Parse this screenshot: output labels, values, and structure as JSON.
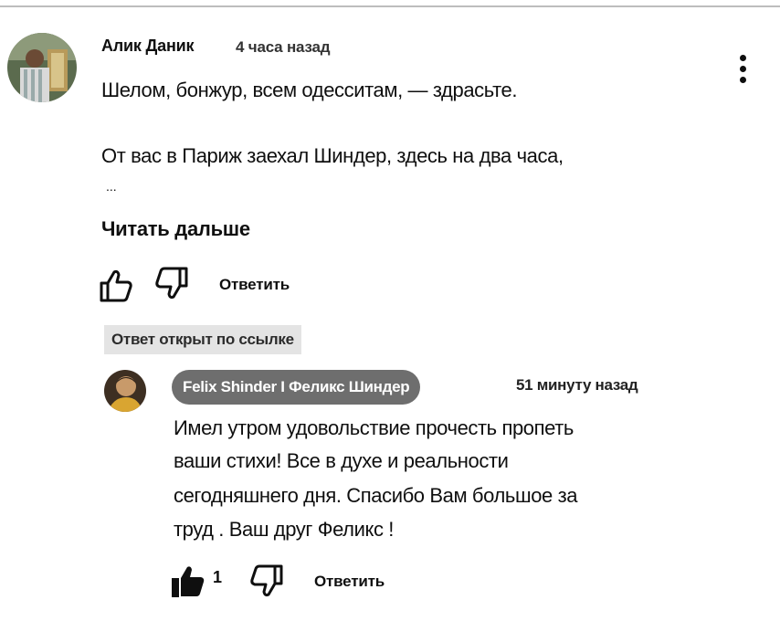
{
  "comment": {
    "author": "Алик Даник",
    "time": "4 часа назад",
    "lines": [
      "Шелом, бонжур, всем одесситам, — здрасьте.",
      "От вас в Париж заехал Шиндер, здесь  на два часа,"
    ],
    "ellipsis": "...",
    "read_more": "Читать дальше",
    "reply_label": "Ответить"
  },
  "linked_badge": "Ответ открыт по ссылке",
  "reply": {
    "author": "Felix Shinder I Феликс Шиндер",
    "time": "51 минуту назад",
    "lines": [
      "Имел утром удовольствие прочесть пропеть",
      "ваши стихи! Все в духе и реальности",
      "сегодняшнего дня. Спасибо Вам большое за",
      "труд . Ваш друг Феликс !"
    ],
    "likes": "1",
    "reply_label": "Ответить"
  },
  "icons": {
    "like": "thumb-up-icon",
    "dislike": "thumb-down-icon",
    "more": "more-vert-icon"
  },
  "colors": {
    "author_chip_bg": "#6e6e6e",
    "badge_bg": "#e4e4e4",
    "text": "#0f0f0f"
  }
}
